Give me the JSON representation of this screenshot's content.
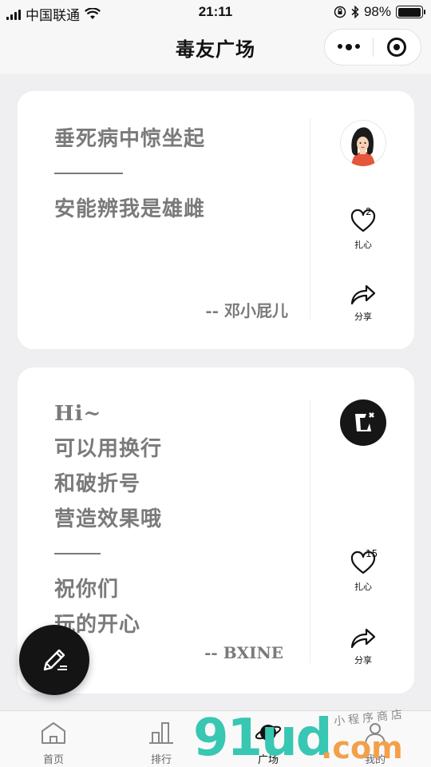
{
  "status_bar": {
    "carrier": "中国联通",
    "time": "21:11",
    "battery": "98%",
    "battery_level": 0.98
  },
  "nav": {
    "title": "毒友广场",
    "more_icon": "more-dots-icon",
    "close_icon": "target-icon"
  },
  "cards": [
    {
      "lines_top": [
        "垂死病中惊坐起"
      ],
      "lines_bottom": [
        "安能辨我是雄雌"
      ],
      "author": "-- 邓小屁儿",
      "like_count": "2",
      "like_label": "扎心",
      "share_label": "分享",
      "avatar": "girl-avatar"
    },
    {
      "lines_top": [
        "Hi~",
        "可以用换行",
        "和破折号",
        "营造效果哦"
      ],
      "lines_bottom": [
        "祝你们",
        "玩的开心"
      ],
      "author": "-- BXINE",
      "like_count": "15",
      "like_label": "扎心",
      "share_label": "分享",
      "avatar": "edit-badge-icon"
    }
  ],
  "tabs": [
    {
      "label": "首页",
      "icon": "home-icon"
    },
    {
      "label": "排行",
      "icon": "bar-chart-icon"
    },
    {
      "label": "广场",
      "icon": "planet-icon",
      "active": true
    },
    {
      "label": "我的",
      "icon": "user-icon"
    }
  ],
  "watermark": {
    "brand": "91ud",
    "domain": ".com",
    "tagline": "小程序商店"
  }
}
